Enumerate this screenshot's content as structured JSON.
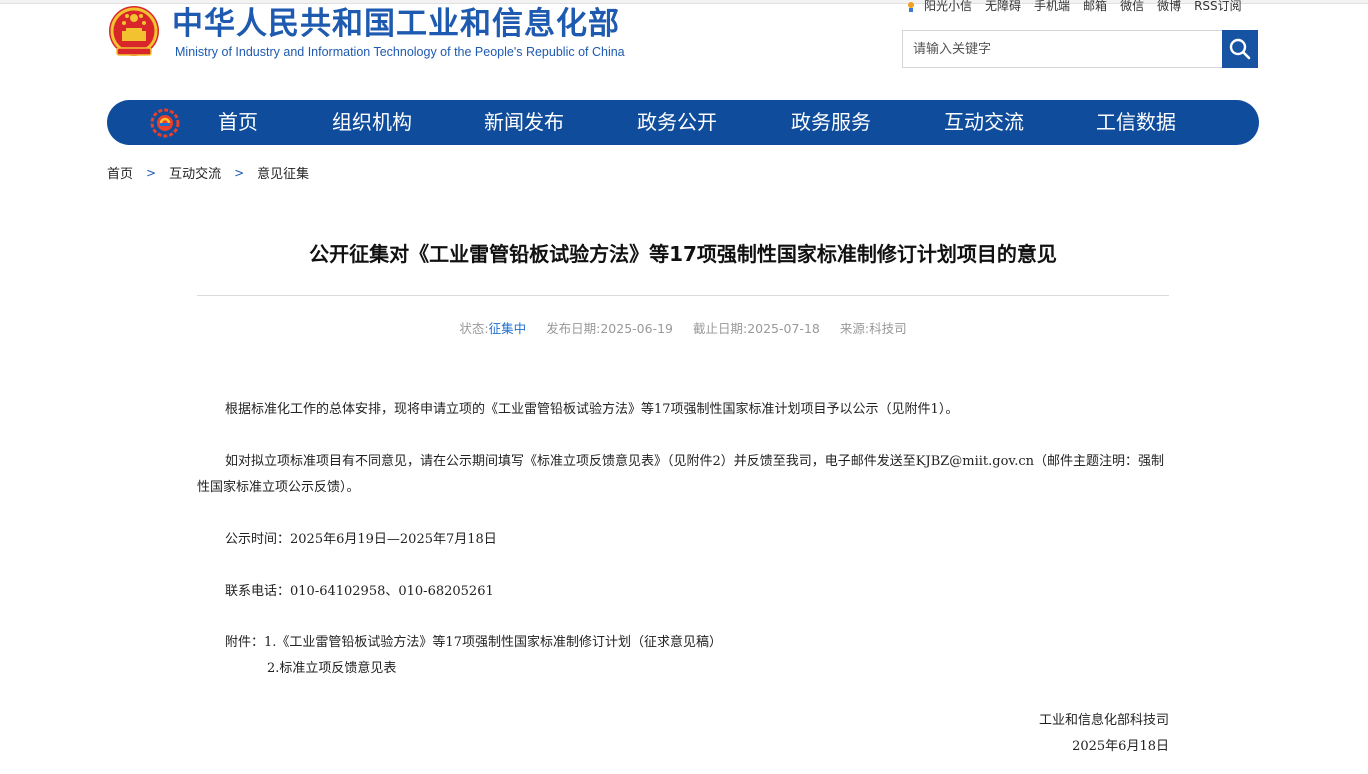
{
  "header": {
    "title_cn": "中华人民共和国工业和信息化部",
    "title_en": "Ministry of Industry and Information Technology of the People's Republic of China",
    "toplinks": [
      "阳光小信",
      "无障碍",
      "手机端",
      "邮箱",
      "微信",
      "微博",
      "RSS订阅"
    ],
    "search_placeholder": "请输入关键字"
  },
  "nav": {
    "items": [
      "首页",
      "组织机构",
      "新闻发布",
      "政务公开",
      "政务服务",
      "互动交流",
      "工信数据"
    ]
  },
  "breadcrumb": [
    "首页",
    "互动交流",
    "意见征集"
  ],
  "breadcrumb_sep": ">",
  "article": {
    "title": "公开征集对《工业雷管铅板试验方法》等17项强制性国家标准制修订计划项目的意见",
    "meta": {
      "status_label": "状态:",
      "status_value": "征集中",
      "publish_label": "发布日期:",
      "publish_value": "2025-06-19",
      "deadline_label": "截止日期:",
      "deadline_value": "2025-07-18",
      "source_label": "来源:",
      "source_value": "科技司"
    },
    "paragraphs": [
      "根据标准化工作的总体安排，现将申请立项的《工业雷管铅板试验方法》等17项强制性国家标准计划项目予以公示（见附件1）。",
      "如对拟立项标准项目有不同意见，请在公示期间填写《标准立项反馈意见表》（见附件2）并反馈至我司，电子邮件发送至KJBZ@miit.gov.cn（邮件主题注明：强制性国家标准立项公示反馈）。",
      "公示时间：2025年6月19日—2025年7月18日",
      "联系电话：010-64102958、010-68205261"
    ],
    "attachments_label": "附件：",
    "attachments": [
      "1.《工业雷管铅板试验方法》等17项强制性国家标准制修订计划（征求意见稿）",
      "2.标准立项反馈意见表"
    ],
    "signature": "工业和信息化部科技司",
    "date": "2025年6月18日"
  },
  "colors": {
    "brand_blue": "#0f4c9c",
    "status_blue": "#1e6fd1"
  }
}
